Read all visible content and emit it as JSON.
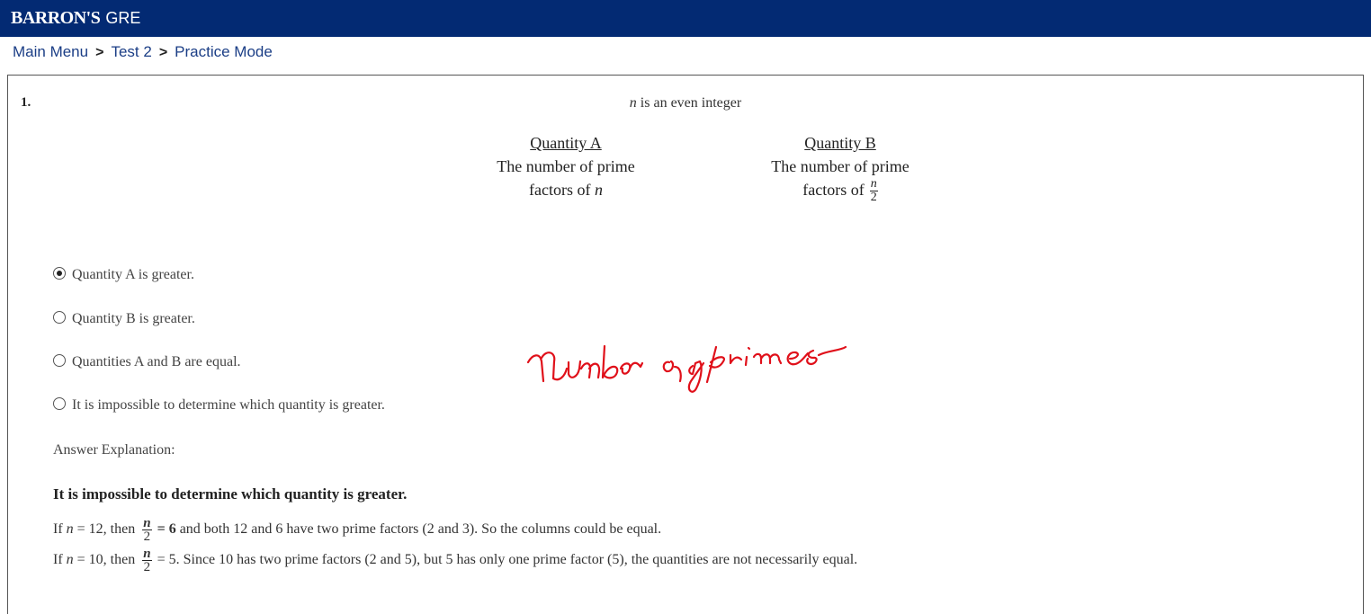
{
  "header": {
    "brand": "BARRON'S",
    "product": "GRE"
  },
  "breadcrumb": [
    "Main Menu",
    "Test 2",
    "Practice Mode"
  ],
  "breadcrumb_separator": ">",
  "question": {
    "number": "1.",
    "stem_var": "n",
    "stem_rest": " is an even integer",
    "quantity_a": {
      "title": "Quantity A",
      "line1": "The number of prime",
      "line2": "factors of ",
      "var": "n"
    },
    "quantity_b": {
      "title": "Quantity B",
      "line1": "The number of prime",
      "line2": "factors of",
      "frac_num": "n",
      "frac_den": "2"
    }
  },
  "choices": [
    {
      "label": "Quantity A is greater.",
      "selected": true
    },
    {
      "label": "Quantity B is greater.",
      "selected": false
    },
    {
      "label": "Quantities A and B are equal.",
      "selected": false
    },
    {
      "label": "It is impossible to determine which quantity is greater.",
      "selected": false
    }
  ],
  "explanation": {
    "label": "Answer Explanation:",
    "answer": "It is impossible to determine which quantity is greater.",
    "line1": {
      "pre": "If ",
      "var": "n",
      "mid": " = 12, then ",
      "frac_num": "n",
      "frac_den": "2",
      "eq": " = 6",
      "post": " and both 12 and 6 have two prime factors (2 and 3). So the columns could be equal."
    },
    "line2": {
      "pre": "If ",
      "var": "n",
      "mid": " = 10, then ",
      "frac_num": "n",
      "frac_den": "2",
      "eq": " = 5",
      "post": ". Since 10 has two prime factors (2 and 5), but 5 has only one prime factor (5), the quantities are not necessarily equal."
    }
  },
  "annotation": {
    "handwriting": "number of primes",
    "color": "#e0101a"
  },
  "colors": {
    "header_bg": "#032a73",
    "link": "#1b3e86"
  }
}
